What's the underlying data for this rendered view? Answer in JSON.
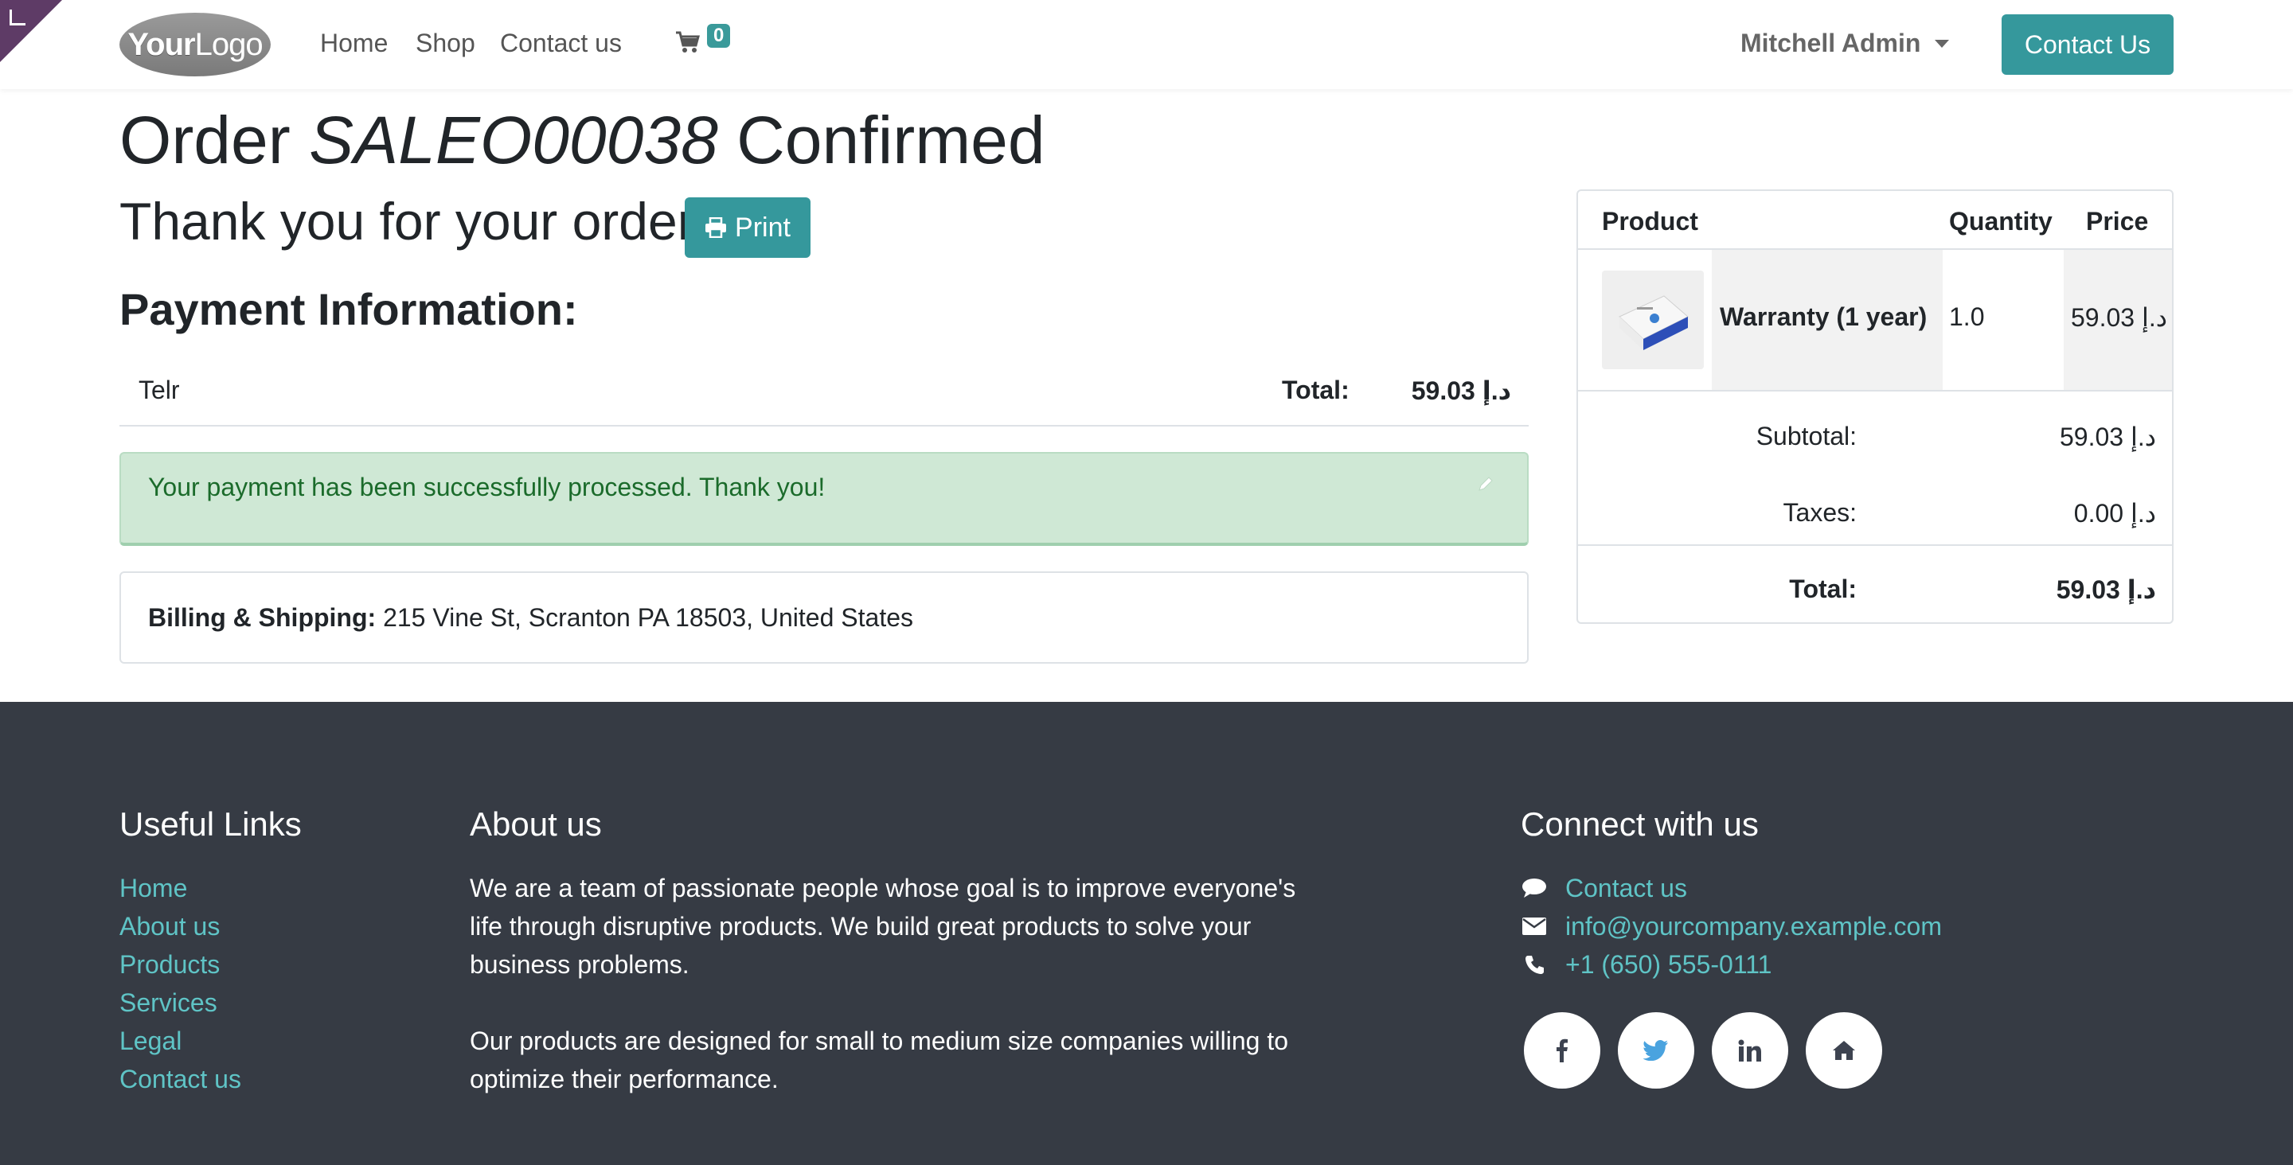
{
  "header": {
    "logo_your": "Your",
    "logo_logo": "Logo",
    "nav": [
      "Home",
      "Shop",
      "Contact us"
    ],
    "cart_count": "0",
    "user_name": "Mitchell Admin",
    "contact_button": "Contact Us"
  },
  "main": {
    "title_prefix": "Order ",
    "order_ref": "SALEO00038",
    "title_suffix": " Confirmed",
    "thanks": "Thank you for your order.",
    "print_label": "Print",
    "payment_heading": "Payment Information:",
    "payment_method": "Telr",
    "payment_total_label": "Total:",
    "payment_total_value": "59.03 د.إ",
    "alert_message": "Your payment has been successfully processed. Thank you!",
    "billing_label": "Billing & Shipping:",
    "billing_address": " 215 Vine St, Scranton PA 18503, United States"
  },
  "order_summary": {
    "headers": {
      "product": "Product",
      "quantity": "Quantity",
      "price": "Price"
    },
    "items": [
      {
        "name": "Warranty (1 year)",
        "quantity": "1.0",
        "price": "59.03 د.إ"
      }
    ],
    "subtotal_label": "Subtotal:",
    "subtotal_value": "59.03 د.إ",
    "taxes_label": "Taxes:",
    "taxes_value": "0.00 د.إ",
    "total_label": "Total:",
    "total_value": "59.03 د.إ"
  },
  "footer": {
    "useful_links_heading": "Useful Links",
    "useful_links": [
      "Home",
      "About us",
      "Products",
      "Services",
      "Legal",
      "Contact us"
    ],
    "about_heading": "About us",
    "about_p1": "We are a team of passionate people whose goal is to improve everyone's life through disruptive products. We build great products to solve your business problems.",
    "about_p2": "Our products are designed for small to medium size companies willing to optimize their performance.",
    "connect_heading": "Connect with us",
    "contact_link": "Contact us",
    "email": "info@yourcompany.example.com",
    "phone": "+1 (650) 555-0111",
    "social_icons": [
      "facebook-icon",
      "twitter-icon",
      "linkedin-icon",
      "home-icon"
    ]
  },
  "colors": {
    "accent": "#35989c",
    "footer_bg": "#363b44",
    "footer_link": "#5fc4c6",
    "alert_bg": "#cfe8d5",
    "alert_text": "#1b6b2b",
    "corner": "#5e3b66"
  }
}
